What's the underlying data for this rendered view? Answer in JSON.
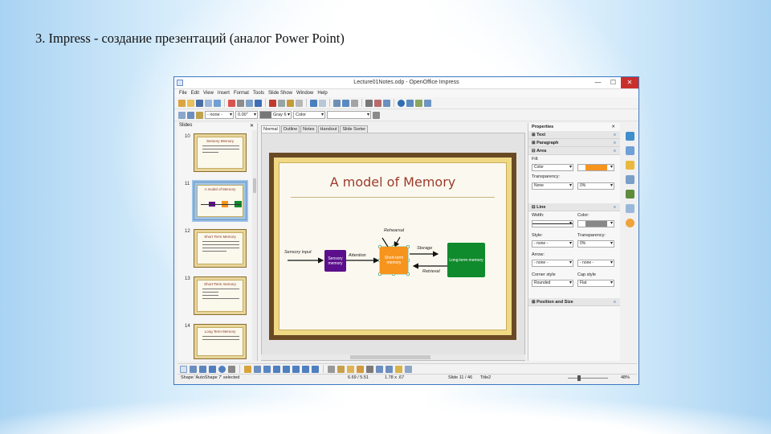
{
  "heading": "3. Impress - создание презентаций (аналог Power Point)",
  "window": {
    "title": "Lecture01Notes.odp - OpenOffice Impress",
    "buttons": {
      "minimize": "—",
      "maximize": "☐",
      "close": "✕"
    }
  },
  "menu": [
    "File",
    "Edit",
    "View",
    "Insert",
    "Format",
    "Tools",
    "Slide Show",
    "Window",
    "Help"
  ],
  "toolbar2": {
    "line_style": "- none -",
    "line_width": "0.00\"",
    "line_color": "Gray 6",
    "area_style": "Color"
  },
  "slides_pane": {
    "title": "Slides",
    "close": "✕",
    "thumbs": [
      {
        "num": "10",
        "title": "Sensory Memory"
      },
      {
        "num": "11",
        "title": "A model of Memory"
      },
      {
        "num": "12",
        "title": "Short Term Memory"
      },
      {
        "num": "13",
        "title": "Short-Term memory"
      },
      {
        "num": "14",
        "title": "Long Term Memory"
      }
    ]
  },
  "view_tabs": [
    "Normal",
    "Outline",
    "Notes",
    "Handout",
    "Slide Sorter"
  ],
  "slide": {
    "title": "A model of Memory",
    "boxes": {
      "sensory": "Sensory memory",
      "shortterm": "Short-term memory",
      "longterm": "Long-term memory"
    },
    "labels": {
      "sensory_input": "Sensory input",
      "attention": "Attention",
      "rehearsal": "Rehearsal",
      "storage": "Storage",
      "retrieval": "Retrieval"
    },
    "colors": {
      "sensory": "#5b0f8c",
      "shortterm": "#f7941d",
      "longterm": "#0f8a2c",
      "title": "#9c3b2c"
    }
  },
  "properties": {
    "title": "Properties",
    "close": "✕",
    "sections": {
      "text": "Text",
      "paragraph": "Paragraph",
      "area": "Area",
      "line": "Line",
      "position": "Position and Size"
    },
    "fill_label": "Fill:",
    "fill_value": "Color",
    "transparency_label": "Transparency:",
    "transparency_value": "None",
    "transparency_pct": "0%",
    "width_label": "Width:",
    "color_label": "Color:",
    "style_label": "Style:",
    "line_transparency_label": "Transparency:",
    "style_value": "- none -",
    "line_transparency_value": "0%",
    "arrow_label": "Arrow:",
    "arrow_start": "- none -",
    "arrow_end": "- none -",
    "corner_label": "Corner style",
    "corner_value": "Rounded",
    "cap_label": "Cap style",
    "cap_value": "Flat"
  },
  "status": {
    "selection": "Shape 'AutoShape 7' selected",
    "position": "6.69 / 5.51",
    "size": "1.78 x .67",
    "slide": "Slide 11 / 46",
    "layout": "Title2",
    "zoom": "48%"
  }
}
